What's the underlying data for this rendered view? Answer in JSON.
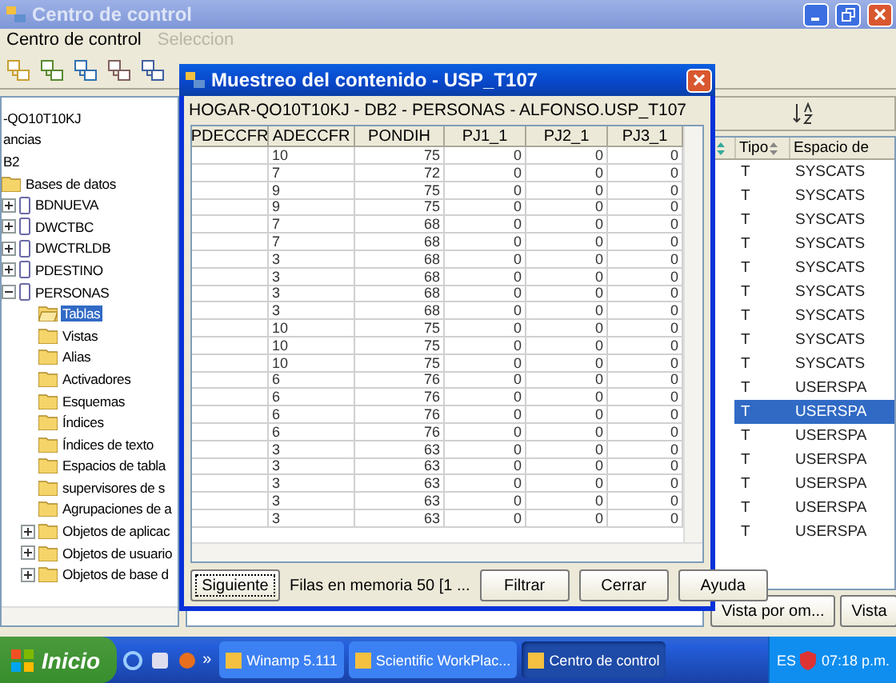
{
  "main_window": {
    "title": "Centro de control",
    "menu": [
      {
        "label": "Centro de control",
        "disabled": false
      },
      {
        "label": "Seleccion",
        "disabled": true
      }
    ],
    "tree": [
      {
        "label": "-QO10T10KJ",
        "kind": "text"
      },
      {
        "label": "ancias",
        "kind": "text"
      },
      {
        "label": "B2",
        "kind": "text"
      },
      {
        "label": "Bases de datos",
        "kind": "folder",
        "selected": false,
        "children": [
          {
            "label": "BDNUEVA",
            "kind": "database",
            "expanded": false,
            "selected": false
          },
          {
            "label": "DWCTBC",
            "kind": "database",
            "expanded": false,
            "selected": false
          },
          {
            "label": "DWCTRLDB",
            "kind": "database",
            "expanded": false,
            "selected": false
          },
          {
            "label": "PDESTINO",
            "kind": "database",
            "expanded": false,
            "selected": false
          },
          {
            "label": "PERSONAS",
            "kind": "database",
            "expanded": true,
            "selected": false,
            "children": [
              {
                "label": "Tablas",
                "kind": "folder",
                "selected": true
              },
              {
                "label": "Vistas",
                "kind": "folder",
                "selected": false
              },
              {
                "label": "Alias",
                "kind": "folder",
                "selected": false
              },
              {
                "label": "Activadores",
                "kind": "folder",
                "selected": false
              },
              {
                "label": "Esquemas",
                "kind": "folder",
                "selected": false
              },
              {
                "label": "Índices",
                "kind": "folder",
                "selected": false
              },
              {
                "label": "Índices de texto",
                "kind": "folder",
                "selected": false
              },
              {
                "label": "Espacios de tabla",
                "kind": "folder",
                "selected": false
              },
              {
                "label": "supervisores de s",
                "kind": "folder",
                "selected": false
              },
              {
                "label": "Agrupaciones de a",
                "kind": "folder",
                "selected": false
              },
              {
                "label": "Objetos de aplicac",
                "kind": "folder",
                "expanded": false,
                "selected": false
              },
              {
                "label": "Objetos de usuario",
                "kind": "folder",
                "expanded": false,
                "selected": false
              },
              {
                "label": "Objetos de base d",
                "kind": "folder",
                "expanded": false,
                "selected": false
              }
            ]
          }
        ]
      }
    ],
    "list": {
      "columns": [
        "Tipo",
        "Espacio de"
      ],
      "rows": [
        {
          "type": "T",
          "tablespace": "SYSCATS",
          "selected": false
        },
        {
          "type": "T",
          "tablespace": "SYSCATS",
          "selected": false
        },
        {
          "type": "T",
          "tablespace": "SYSCATS",
          "selected": false
        },
        {
          "type": "T",
          "tablespace": "SYSCATS",
          "selected": false
        },
        {
          "type": "T",
          "tablespace": "SYSCATS",
          "selected": false
        },
        {
          "type": "T",
          "tablespace": "SYSCATS",
          "selected": false
        },
        {
          "type": "T",
          "tablespace": "SYSCATS",
          "selected": false
        },
        {
          "type": "T",
          "tablespace": "SYSCATS",
          "selected": false
        },
        {
          "type": "T",
          "tablespace": "SYSCATS",
          "selected": false
        },
        {
          "type": "T",
          "tablespace": "USERSPA",
          "selected": false
        },
        {
          "type": "T",
          "tablespace": "USERSPA",
          "selected": true
        },
        {
          "type": "T",
          "tablespace": "USERSPA",
          "selected": false
        },
        {
          "type": "T",
          "tablespace": "USERSPA",
          "selected": false
        },
        {
          "type": "T",
          "tablespace": "USERSPA",
          "selected": false
        },
        {
          "type": "T",
          "tablespace": "USERSPA",
          "selected": false
        },
        {
          "type": "T",
          "tablespace": "USERSPA",
          "selected": false
        }
      ],
      "buttons": [
        "Vista por om...",
        "Vista"
      ]
    }
  },
  "dialog": {
    "title": "Muestreo del contenido - USP_T107",
    "path": "HOGAR-QO10T10KJ - DB2 - PERSONAS - ALFONSO.USP_T107",
    "columns": [
      "PDECCFR",
      "ADECCFR",
      "PONDIH",
      "PJ1_1",
      "PJ2_1",
      "PJ3_1"
    ],
    "rows": [
      {
        "cells": [
          "",
          "10",
          "75",
          "0",
          "0",
          "0"
        ]
      },
      {
        "cells": [
          "",
          "7",
          "72",
          "0",
          "0",
          "0"
        ]
      },
      {
        "cells": [
          "",
          "9",
          "75",
          "0",
          "0",
          "0"
        ]
      },
      {
        "cells": [
          "",
          "9",
          "75",
          "0",
          "0",
          "0"
        ]
      },
      {
        "cells": [
          "",
          "7",
          "68",
          "0",
          "0",
          "0"
        ]
      },
      {
        "cells": [
          "",
          "7",
          "68",
          "0",
          "0",
          "0"
        ]
      },
      {
        "cells": [
          "",
          "3",
          "68",
          "0",
          "0",
          "0"
        ]
      },
      {
        "cells": [
          "",
          "3",
          "68",
          "0",
          "0",
          "0"
        ]
      },
      {
        "cells": [
          "",
          "3",
          "68",
          "0",
          "0",
          "0"
        ]
      },
      {
        "cells": [
          "",
          "3",
          "68",
          "0",
          "0",
          "0"
        ]
      },
      {
        "cells": [
          "",
          "10",
          "75",
          "0",
          "0",
          "0"
        ]
      },
      {
        "cells": [
          "",
          "10",
          "75",
          "0",
          "0",
          "0"
        ]
      },
      {
        "cells": [
          "",
          "10",
          "75",
          "0",
          "0",
          "0"
        ]
      },
      {
        "cells": [
          "",
          "6",
          "76",
          "0",
          "0",
          "0"
        ]
      },
      {
        "cells": [
          "",
          "6",
          "76",
          "0",
          "0",
          "0"
        ]
      },
      {
        "cells": [
          "",
          "6",
          "76",
          "0",
          "0",
          "0"
        ]
      },
      {
        "cells": [
          "",
          "6",
          "76",
          "0",
          "0",
          "0"
        ]
      },
      {
        "cells": [
          "",
          "3",
          "63",
          "0",
          "0",
          "0"
        ]
      },
      {
        "cells": [
          "",
          "3",
          "63",
          "0",
          "0",
          "0"
        ]
      },
      {
        "cells": [
          "",
          "3",
          "63",
          "0",
          "0",
          "0"
        ]
      },
      {
        "cells": [
          "",
          "3",
          "63",
          "0",
          "0",
          "0"
        ]
      },
      {
        "cells": [
          "",
          "3",
          "63",
          "0",
          "0",
          "0"
        ]
      }
    ],
    "footer": [
      {
        "kind": "button",
        "label": "Siguiente",
        "focused": true
      },
      {
        "kind": "text",
        "label": "Filas en memoria  50  [1 ..."
      },
      {
        "kind": "button",
        "label": "Filtrar",
        "focused": false
      },
      {
        "kind": "button",
        "label": "Cerrar",
        "focused": false
      },
      {
        "kind": "button",
        "label": "Ayuda",
        "focused": false
      }
    ]
  },
  "taskbar": {
    "start": "Inicio",
    "more": "»",
    "tasks": [
      {
        "label": "Winamp 5.111",
        "selected": false
      },
      {
        "label": "Scientific WorkPlac...",
        "selected": false
      },
      {
        "label": "Centro de control",
        "selected": true
      }
    ],
    "language": "ES",
    "time": "07:18 p.m."
  }
}
